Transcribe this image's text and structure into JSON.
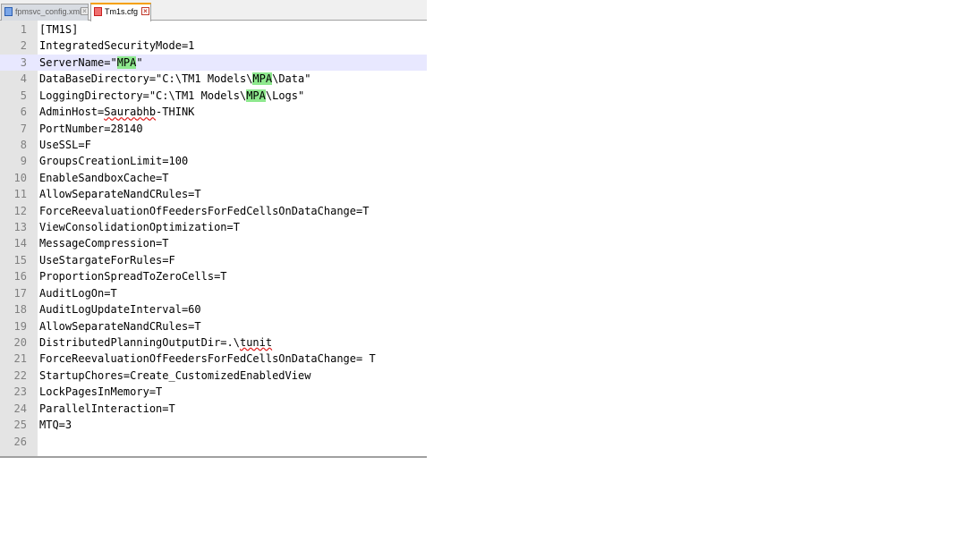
{
  "tabs": [
    {
      "label": "fpmsvc_config.xml",
      "active": false
    },
    {
      "label": "Tm1s.cfg",
      "active": true
    }
  ],
  "lines": [
    {
      "num": "1",
      "text": "[TM1S]"
    },
    {
      "num": "2",
      "text": "IntegratedSecurityMode=1"
    },
    {
      "num": "3",
      "text": "ServerName=\"MPA\""
    },
    {
      "num": "4",
      "text": "DataBaseDirectory=\"C:\\TM1 Models\\MPA\\Data\""
    },
    {
      "num": "5",
      "text": "LoggingDirectory=\"C:\\TM1 Models\\MPA\\Logs\""
    },
    {
      "num": "6",
      "text": "AdminHost=Saurabhb-THINK"
    },
    {
      "num": "7",
      "text": "PortNumber=28140"
    },
    {
      "num": "8",
      "text": "UseSSL=F"
    },
    {
      "num": "9",
      "text": "GroupsCreationLimit=100"
    },
    {
      "num": "10",
      "text": "EnableSandboxCache=T"
    },
    {
      "num": "11",
      "text": "AllowSeparateNandCRules=T"
    },
    {
      "num": "12",
      "text": "ForceReevaluationOfFeedersForFedCellsOnDataChange=T"
    },
    {
      "num": "13",
      "text": "ViewConsolidationOptimization=T"
    },
    {
      "num": "14",
      "text": "MessageCompression=T"
    },
    {
      "num": "15",
      "text": "UseStargateForRules=F"
    },
    {
      "num": "16",
      "text": "ProportionSpreadToZeroCells=T"
    },
    {
      "num": "17",
      "text": "AuditLogOn=T"
    },
    {
      "num": "18",
      "text": "AuditLogUpdateInterval=60"
    },
    {
      "num": "19",
      "text": "AllowSeparateNandCRules=T"
    },
    {
      "num": "20",
      "text": "DistributedPlanningOutputDir=.\\tunit"
    },
    {
      "num": "21",
      "text": "ForceReevaluationOfFeedersForFedCellsOnDataChange= T"
    },
    {
      "num": "22",
      "text": "StartupChores=Create_CustomizedEnabledView"
    },
    {
      "num": "23",
      "text": "LockPagesInMemory=T"
    },
    {
      "num": "24",
      "text": "ParallelInteraction=T"
    },
    {
      "num": "25",
      "text": "MTQ=3"
    },
    {
      "num": "26",
      "text": ""
    }
  ],
  "current_line": "3",
  "highlight_word": "MPA",
  "squiggle_words": [
    "Saurabhb",
    "tunit"
  ],
  "colors": {
    "highlight": "#8ee88e",
    "current_line": "#e8e8ff",
    "gutter": "#e4e4e4",
    "active_tab_accent": "#f5a000"
  }
}
